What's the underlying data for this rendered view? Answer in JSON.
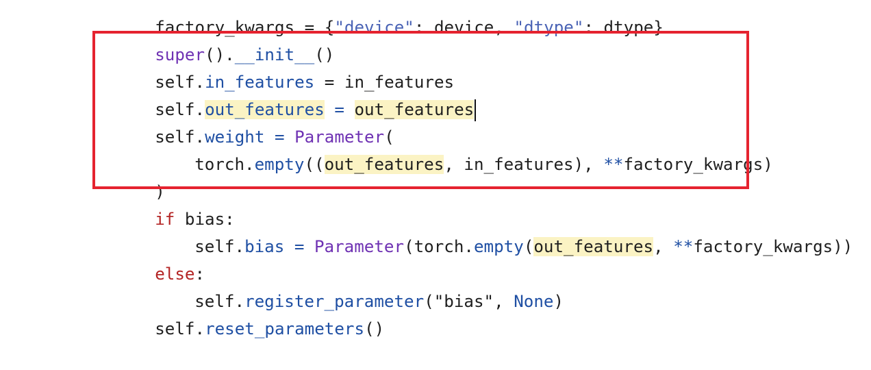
{
  "code": {
    "line0": {
      "a": "factory_kwargs = {",
      "b": "\"device\"",
      "c": ": device, ",
      "d": "\"dtype\"",
      "e": ": dtype}"
    },
    "line1": {
      "a": "super",
      "b": "().",
      "c": "__init__",
      "d": "()"
    },
    "line2": {
      "self": "self.",
      "attr": "in_features",
      "rest": " = in_features"
    },
    "line3": {
      "self": "self.",
      "attr": "out_features",
      "eq": " = ",
      "val": "out_features"
    },
    "line4": {
      "self": "self.",
      "attr": "weight",
      "eq": " = ",
      "cls": "Parameter",
      "rest": "("
    },
    "line5": {
      "a": "torch.",
      "fn": "empty",
      "b": "((",
      "hl": "out_features",
      "c": ", in_features), ",
      "op": "**",
      "d": "factory_kwargs)"
    },
    "line6": {
      "a": ")"
    },
    "line7": {
      "kw": "if",
      "rest": " bias:"
    },
    "line8": {
      "self": "self.",
      "attr": "bias",
      "eq": " = ",
      "cls": "Parameter",
      "b": "(torch.",
      "fn": "empty",
      "c": "(",
      "hl": "out_features",
      "d": ", ",
      "op": "**",
      "e": "factory_kwargs))"
    },
    "line9": {
      "kw": "else",
      "rest": ":"
    },
    "line10": {
      "self": "self.",
      "fn": "register_parameter",
      "a": "(\"bias\", ",
      "none": "None",
      "b": ")"
    },
    "line11": {
      "self": "self.",
      "fn": "reset_parameters",
      "a": "()"
    }
  },
  "colors": {
    "highlight_border": "#e5232f",
    "occurrence_highlight": "#fbf3c4",
    "attribute": "#1f4fa3",
    "class_name": "#6f32b3",
    "keyword": "#b42525"
  }
}
